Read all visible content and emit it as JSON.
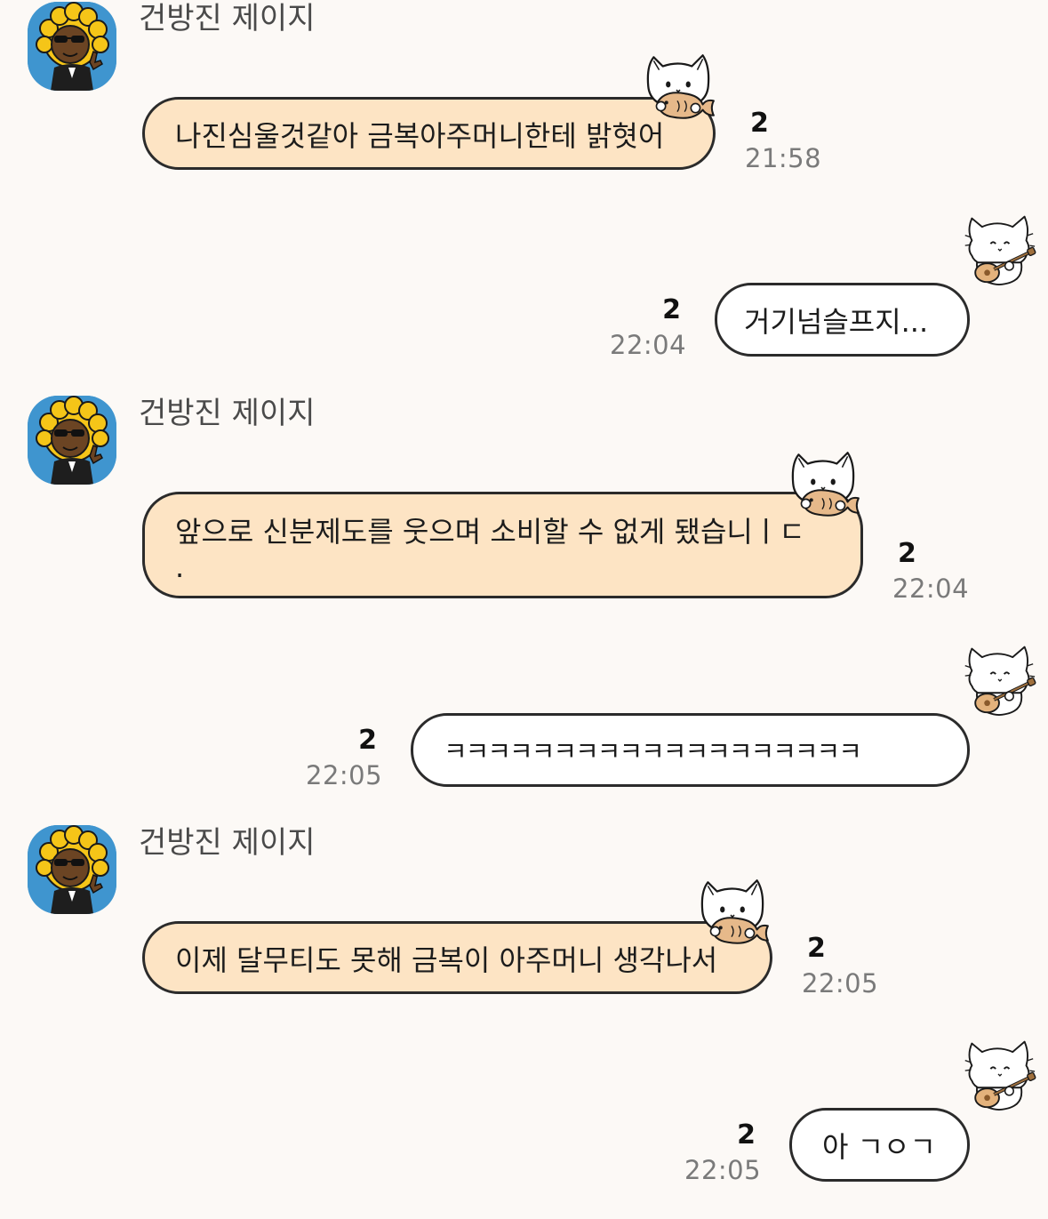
{
  "messages": [
    {
      "direction": "incoming",
      "sender": "건방진 제이지",
      "text": "나진심울것같아 금복아주머니한테 밝혓어",
      "read_count": "2",
      "time": "21:58"
    },
    {
      "direction": "outgoing",
      "text": "거기넘슬프지...",
      "read_count": "2",
      "time": "22:04"
    },
    {
      "direction": "incoming",
      "sender": "건방진 제이지",
      "text": "앞으로 신분제도를 웃으며 소비할 수 없게 됐습니ㅣㄷ\n.",
      "read_count": "2",
      "time": "22:04"
    },
    {
      "direction": "outgoing",
      "text": "ㅋㅋㅋㅋㅋㅋㅋㅋㅋㅋㅋㅋㅋㅋㅋㅋㅋㅋㅋ",
      "read_count": "2",
      "time": "22:05"
    },
    {
      "direction": "incoming",
      "sender": "건방진 제이지",
      "text": "이제 달무티도 못해 금복이 아주머니 생각나서",
      "read_count": "2",
      "time": "22:05"
    },
    {
      "direction": "outgoing",
      "text": "아 ㄱㅇㄱ",
      "read_count": "2",
      "time": "22:05"
    }
  ],
  "colors": {
    "background": "#fcf9f6",
    "incoming_bubble": "#fde4c4",
    "outgoing_bubble": "#ffffff",
    "bubble_border": "#2b2b2b",
    "avatar_bg": "#3f95cf",
    "time_text": "#7a7a7a"
  },
  "icons": {
    "avatar": "jay-g-character-avatar",
    "incoming_sticker": "cat-holding-taiyaki-sticker",
    "outgoing_sticker": "cat-playing-guitar-sticker"
  }
}
